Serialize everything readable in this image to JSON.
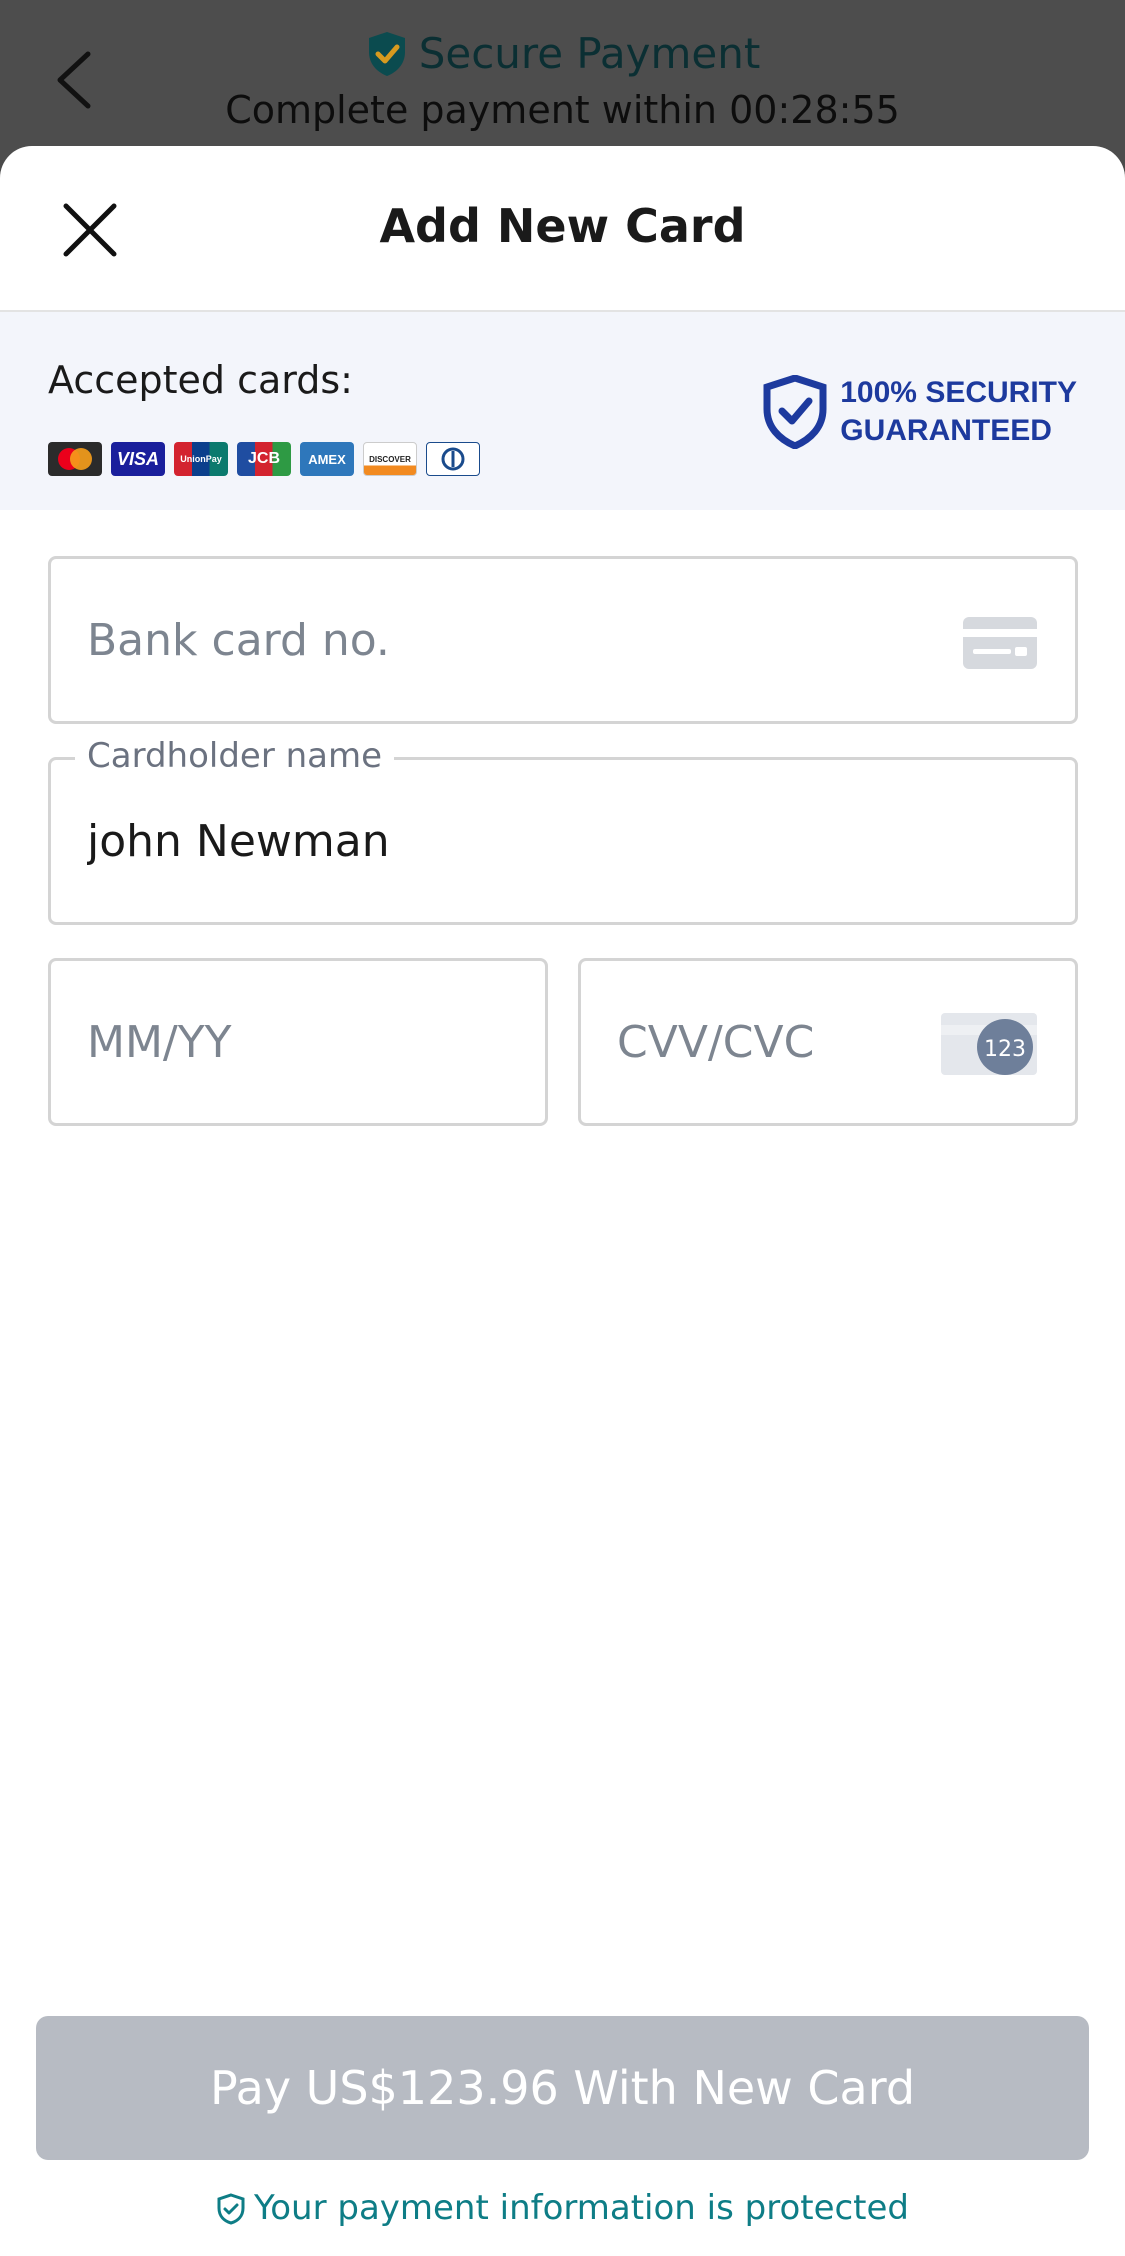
{
  "background": {
    "title": "Secure Payment",
    "subtitle_prefix": "Complete payment within",
    "timer": "00:28:55"
  },
  "sheet": {
    "title": "Add New Card"
  },
  "accepted": {
    "label": "Accepted cards:",
    "logos": [
      "mastercard-logo",
      "visa-logo",
      "unionpay-logo",
      "jcb-logo",
      "amex-logo",
      "discover-logo",
      "diners-logo"
    ],
    "logo_texts": {
      "visa": "VISA",
      "unionpay": "UnionPay",
      "jcb": "JCB",
      "amex": "AMEX",
      "discover": "DISCOVER"
    },
    "security_line1": "100% SECURITY",
    "security_line2": "GUARANTEED"
  },
  "form": {
    "card_number_placeholder": "Bank card no.",
    "card_number_value": "",
    "cardholder_label": "Cardholder name",
    "cardholder_value": "john Newman",
    "expiry_placeholder": "MM/YY",
    "cvv_placeholder": "CVV/CVC",
    "cvv_icon_text": "123"
  },
  "footer": {
    "pay_button": "Pay US$123.96 With New Card",
    "protected_text": "Your payment information is protected"
  },
  "colors": {
    "accent_teal": "#0e7d86",
    "security_blue": "#1d3a9e",
    "pay_button_disabled": "#b7bbc3"
  }
}
